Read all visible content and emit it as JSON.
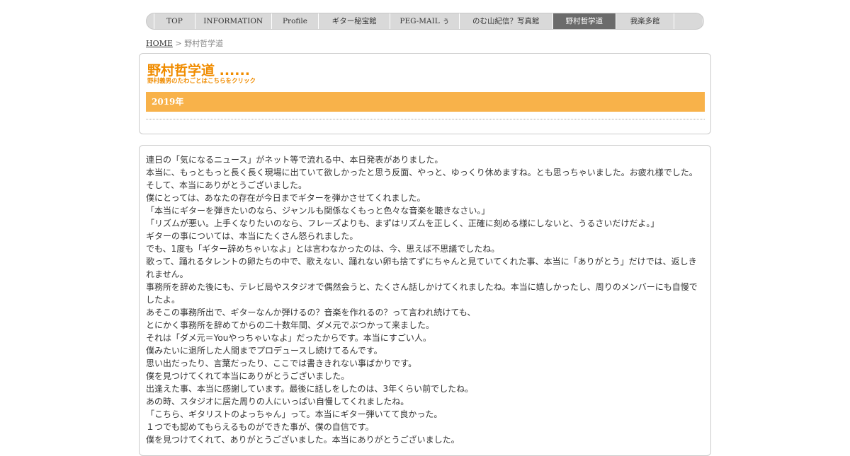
{
  "nav": {
    "items": [
      {
        "label": "TOP",
        "active": false
      },
      {
        "label": "INFORMATION",
        "active": false
      },
      {
        "label": "Profile",
        "active": false
      },
      {
        "label": "ギター秘宝館",
        "active": false
      },
      {
        "label": "PEG-MAIL ぅ",
        "active": false
      },
      {
        "label": "のむ山紀信？写真館",
        "active": false
      },
      {
        "label": "野村哲学道",
        "active": true
      },
      {
        "label": "我楽多館",
        "active": false
      }
    ]
  },
  "breadcrumb": {
    "home": "HOME",
    "separator": ">",
    "current": "野村哲学道"
  },
  "header": {
    "title": "野村哲学道 ......",
    "subtitle": "野村義男のたわごとはこちらをクリック",
    "year": "2019年"
  },
  "article": {
    "lines": [
      "連日の「気になるニュース」がネット等で流れる中、本日発表がありました。",
      "本当に、もっともっと長く長く現場に出ていて欲しかったと思う反面、やっと、ゆっくり休めますね。とも思っちゃいました。お疲れ様でした。",
      "そして、本当にありがとうございました。",
      "僕にとっては、あなたの存在が今日までギターを弾かさせてくれました。",
      "「本当にギターを弾きたいのなら、ジャンルも関係なくもっと色々な音楽を聴きなさい。」",
      "「リズムが悪い。上手くなりたいのなら、フレーズよりも、まずはリズムを正しく、正確に刻める様にしないと、うるさいだけだよ。」",
      "ギターの事については、本当にたくさん怒られました。",
      "でも、1度も「ギター辞めちゃいなよ」とは言わなかったのは、今、思えば不思議でしたね。",
      "歌って、踊れるタレントの卵たちの中で、歌えない、踊れない卵も捨てずにちゃんと見ていてくれた事、本当に「ありがとう」だけでは、返しきれません。",
      "事務所を辞めた後にも、テレビ局やスタジオで偶然会うと、たくさん話しかけてくれましたね。本当に嬉しかったし、周りのメンバーにも自慢でしたよ。",
      "あそこの事務所出で、ギターなんか弾けるの？音楽を作れるの？って言われ続けても、",
      "とにかく事務所を辞めてからの二十数年間、ダメ元でぶつかって来ました。",
      "それは「ダメ元＝Youやっちゃいなよ」だったからです。本当にすごい人。",
      "僕みたいに退所した人間までプロデュースし続けてるんです。",
      "思い出だったり、言葉だったり、ここでは書ききれない事ばかりです。",
      "僕を見つけてくれて本当にありがとうございました。",
      "出逢えた事、本当に感謝しています。最後に話しをしたのは、3年くらい前でしたね。",
      "あの時、スタジオに居た周りの人にいっぱい自慢してくれましたね。",
      "「こちら、ギタリストのよっちゃん」って。本当にギター弾いてて良かった。",
      "１つでも認めてもらえるものができた事が、僕の自信です。",
      "僕を見つけてくれて、ありがとうございました。本当にありがとうございました。"
    ]
  }
}
